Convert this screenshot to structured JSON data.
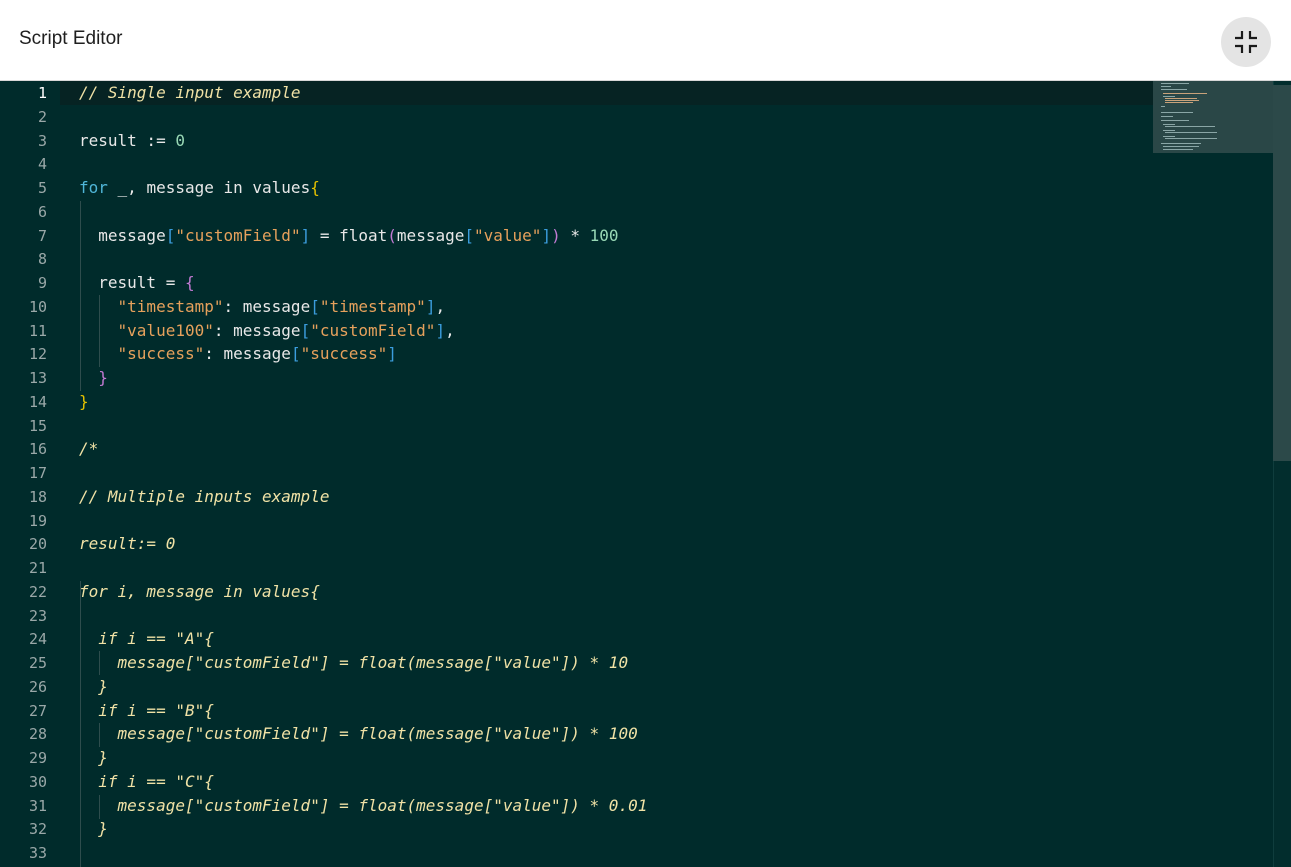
{
  "header": {
    "title": "Script Editor",
    "collapse_icon": "collapse-icon"
  },
  "editor": {
    "active_line": 1,
    "lines": [
      {
        "n": "1",
        "comment": true,
        "tokens": [
          [
            "// Single input example",
            ""
          ]
        ]
      },
      {
        "n": "2",
        "tokens": []
      },
      {
        "n": "3",
        "tokens": [
          [
            "result := ",
            ""
          ],
          [
            "0",
            "num"
          ]
        ]
      },
      {
        "n": "4",
        "tokens": []
      },
      {
        "n": "5",
        "tokens": [
          [
            "for",
            "kw"
          ],
          [
            " _, message in values",
            ""
          ],
          [
            "{",
            "y"
          ]
        ]
      },
      {
        "n": "6",
        "tokens": []
      },
      {
        "n": "7",
        "tokens": [
          [
            "  message",
            ""
          ],
          [
            "[",
            "b"
          ],
          [
            "\"customField\"",
            "str"
          ],
          [
            "]",
            "b"
          ],
          [
            " = float",
            ""
          ],
          [
            "(",
            "p"
          ],
          [
            "message",
            ""
          ],
          [
            "[",
            "b"
          ],
          [
            "\"value\"",
            "str"
          ],
          [
            "]",
            "b"
          ],
          [
            ")",
            "p"
          ],
          [
            " * ",
            ""
          ],
          [
            "100",
            "num"
          ]
        ]
      },
      {
        "n": "8",
        "tokens": []
      },
      {
        "n": "9",
        "tokens": [
          [
            "  result = ",
            ""
          ],
          [
            "{",
            "p"
          ]
        ]
      },
      {
        "n": "10",
        "tokens": [
          [
            "    ",
            ""
          ],
          [
            "\"timestamp\"",
            "str"
          ],
          [
            ": message",
            ""
          ],
          [
            "[",
            "b"
          ],
          [
            "\"timestamp\"",
            "str"
          ],
          [
            "]",
            "b"
          ],
          [
            ",",
            ""
          ]
        ]
      },
      {
        "n": "11",
        "tokens": [
          [
            "    ",
            ""
          ],
          [
            "\"value100\"",
            "str"
          ],
          [
            ": message",
            ""
          ],
          [
            "[",
            "b"
          ],
          [
            "\"customField\"",
            "str"
          ],
          [
            "]",
            "b"
          ],
          [
            ",",
            ""
          ]
        ]
      },
      {
        "n": "12",
        "tokens": [
          [
            "    ",
            ""
          ],
          [
            "\"success\"",
            "str"
          ],
          [
            ": message",
            ""
          ],
          [
            "[",
            "b"
          ],
          [
            "\"success\"",
            "str"
          ],
          [
            "]",
            "b"
          ]
        ]
      },
      {
        "n": "13",
        "tokens": [
          [
            "  ",
            ""
          ],
          [
            "}",
            "p"
          ]
        ]
      },
      {
        "n": "14",
        "tokens": [
          [
            "}",
            "y"
          ]
        ]
      },
      {
        "n": "15",
        "tokens": []
      },
      {
        "n": "16",
        "comment": true,
        "tokens": [
          [
            "/*",
            ""
          ]
        ]
      },
      {
        "n": "17",
        "tokens": []
      },
      {
        "n": "18",
        "comment": true,
        "tokens": [
          [
            "// Multiple inputs example",
            ""
          ]
        ]
      },
      {
        "n": "19",
        "tokens": []
      },
      {
        "n": "20",
        "comment": true,
        "tokens": [
          [
            "result:= 0",
            ""
          ]
        ]
      },
      {
        "n": "21",
        "tokens": []
      },
      {
        "n": "22",
        "comment": true,
        "tokens": [
          [
            "for i, message in values{",
            ""
          ]
        ]
      },
      {
        "n": "23",
        "tokens": []
      },
      {
        "n": "24",
        "comment": true,
        "tokens": [
          [
            "  if i == \"A\"{",
            ""
          ]
        ]
      },
      {
        "n": "25",
        "comment": true,
        "tokens": [
          [
            "    message[\"customField\"] = float(message[\"value\"]) * 10",
            ""
          ]
        ]
      },
      {
        "n": "26",
        "comment": true,
        "tokens": [
          [
            "  }",
            ""
          ]
        ]
      },
      {
        "n": "27",
        "comment": true,
        "tokens": [
          [
            "  if i == \"B\"{",
            ""
          ]
        ]
      },
      {
        "n": "28",
        "comment": true,
        "tokens": [
          [
            "    message[\"customField\"] = float(message[\"value\"]) * 100",
            ""
          ]
        ]
      },
      {
        "n": "29",
        "comment": true,
        "tokens": [
          [
            "  }",
            ""
          ]
        ]
      },
      {
        "n": "30",
        "comment": true,
        "tokens": [
          [
            "  if i == \"C\"{",
            ""
          ]
        ]
      },
      {
        "n": "31",
        "comment": true,
        "tokens": [
          [
            "    message[\"customField\"] = float(message[\"value\"]) * 0.01",
            ""
          ]
        ]
      },
      {
        "n": "32",
        "comment": true,
        "tokens": [
          [
            "  }",
            ""
          ]
        ]
      },
      {
        "n": "33",
        "tokens": []
      }
    ]
  }
}
